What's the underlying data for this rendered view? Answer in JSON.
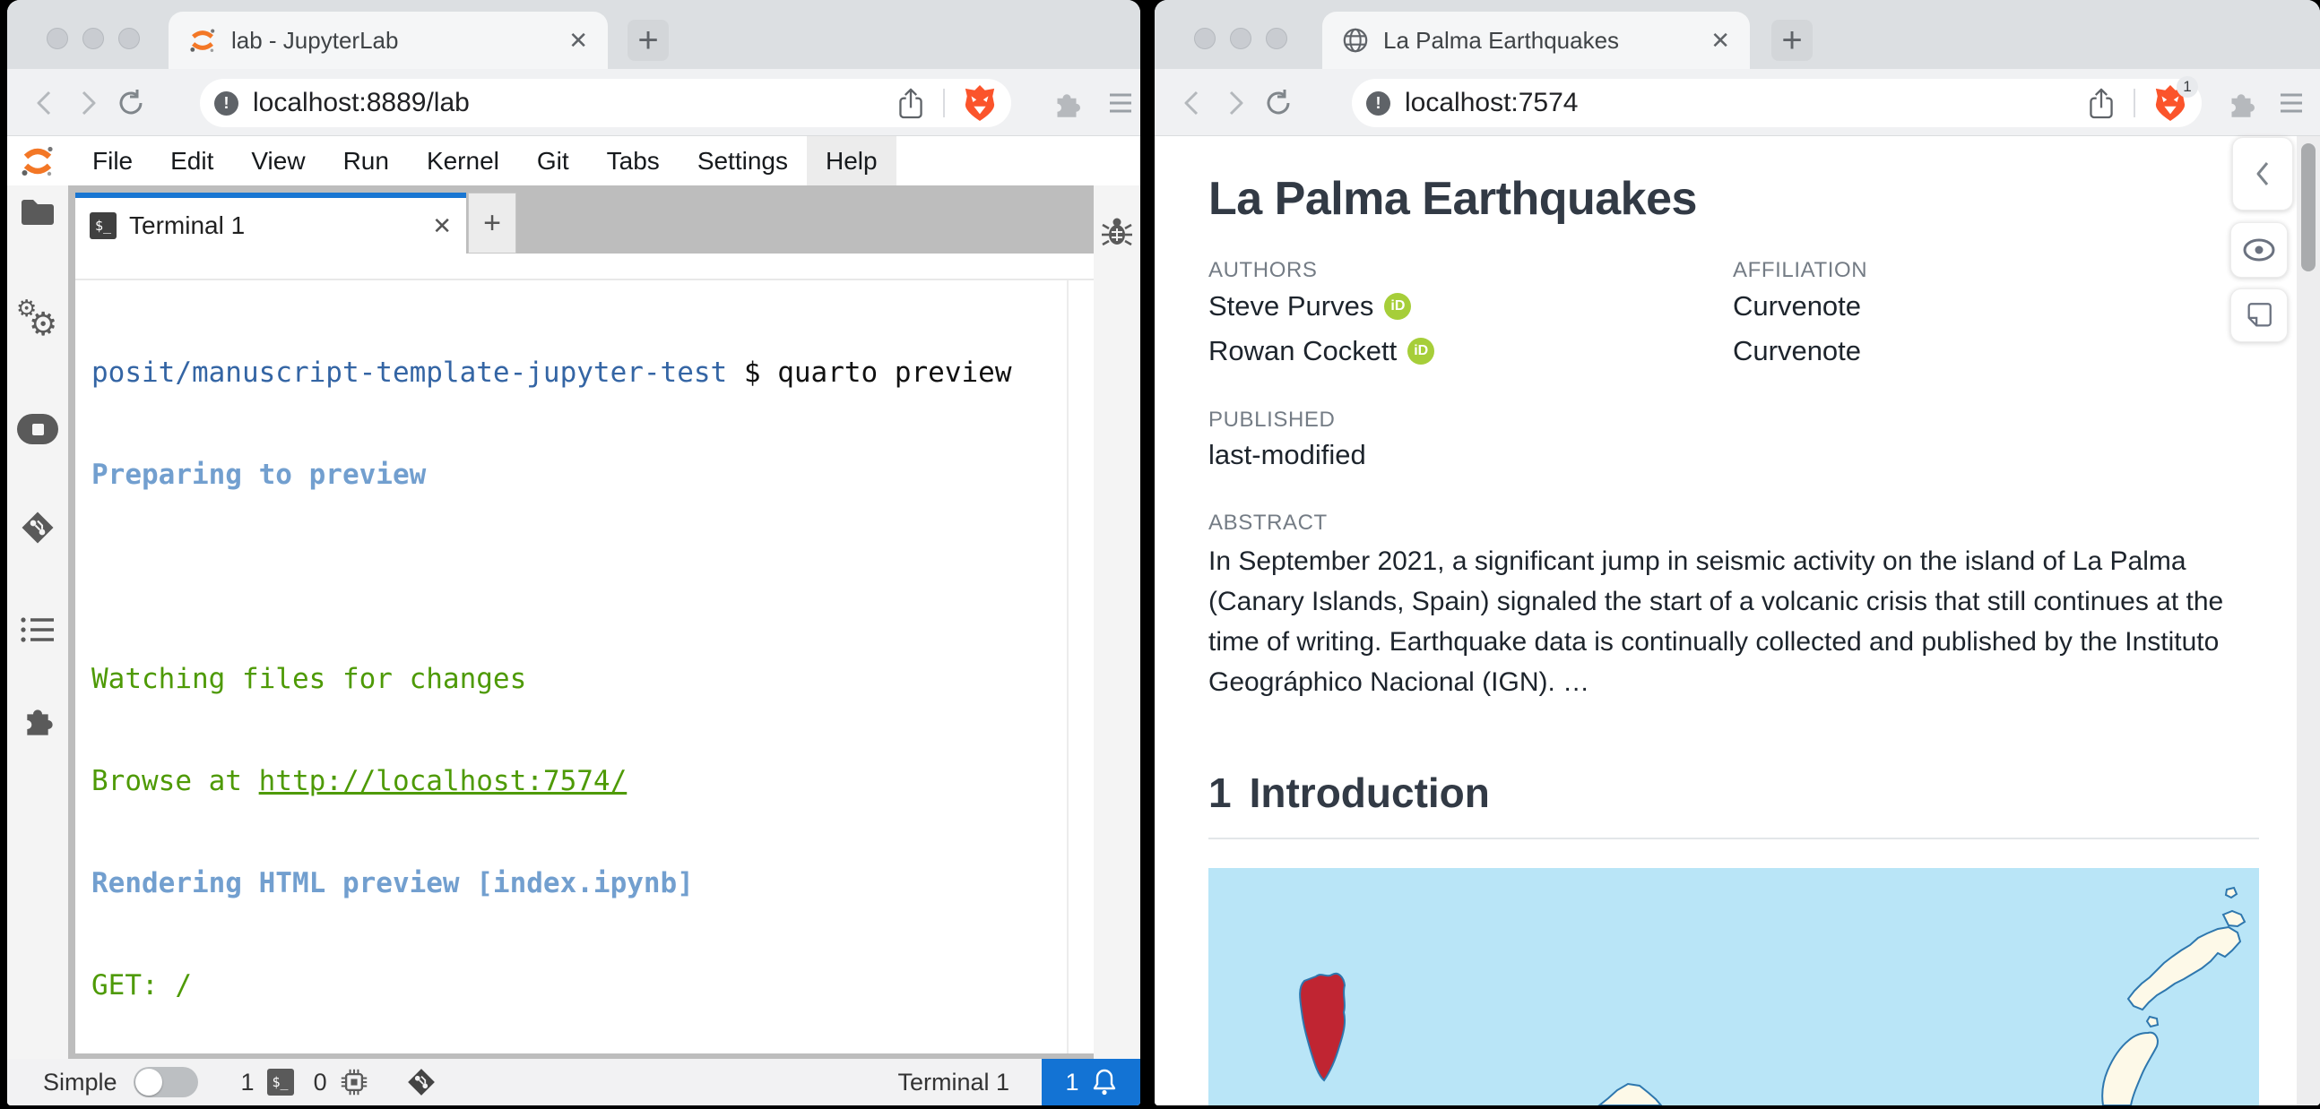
{
  "chrome": {
    "close_glyph": "✕",
    "new_tab_glyph": "+",
    "info_glyph": "!",
    "terminal_glyph": "$_",
    "accent_blue": "#1976d2",
    "brave_orange": "#fb542b",
    "orcid_green": "#a6ce39",
    "orcid_text": "iD"
  },
  "left": {
    "tab_title": "lab - JupyterLab",
    "url": "localhost:8889/lab",
    "menu": [
      "File",
      "Edit",
      "View",
      "Run",
      "Kernel",
      "Git",
      "Tabs",
      "Settings",
      "Help"
    ],
    "menu_active": "Help",
    "dock_tab": "Terminal 1",
    "terminal": {
      "prompt_path": "posit/manuscript-template-jupyter-test",
      "prompt_cmd": " $ quarto preview",
      "preparing": "Preparing to preview",
      "watching": "Watching files for changes",
      "browse_prefix": "Browse at ",
      "browse_url": "http://localhost:7574/",
      "rendering": "Rendering HTML preview [index.ipynb]",
      "get": "GET: /"
    },
    "terminal_colors": {
      "path_blue": "#3465a4",
      "info_blue": "#729fcf",
      "green": "#4e9a06"
    },
    "status": {
      "simple_label": "Simple",
      "terminal_count": "1",
      "kernel_count": "0",
      "context": "Terminal 1",
      "notification_count": "1"
    }
  },
  "right": {
    "tab_title": "La Palma Earthquakes",
    "url": "localhost:7574",
    "shield_badge": "1",
    "page": {
      "title": "La Palma Earthquakes",
      "authors_label": "AUTHORS",
      "affiliation_label": "AFFILIATION",
      "authors": [
        {
          "name": "Steve Purves",
          "affiliation": "Curvenote"
        },
        {
          "name": "Rowan Cockett",
          "affiliation": "Curvenote"
        }
      ],
      "published_label": "PUBLISHED",
      "published_value": "last-modified",
      "abstract_label": "ABSTRACT",
      "abstract": "In September 2021, a significant jump in seismic activity on the island of La Palma (Canary Islands, Spain) signaled the start of a volcanic crisis that still continues at the time of writing. Earthquake data is continually collected and published by the Instituto Geográphico Nacional (IGN). …",
      "section_number": "1",
      "section_title": "Introduction"
    },
    "map_colors": {
      "sea": "#b9e5f7",
      "island": "#fdf9e8",
      "highlight": "#c02532",
      "outline": "#2e77ae"
    }
  }
}
